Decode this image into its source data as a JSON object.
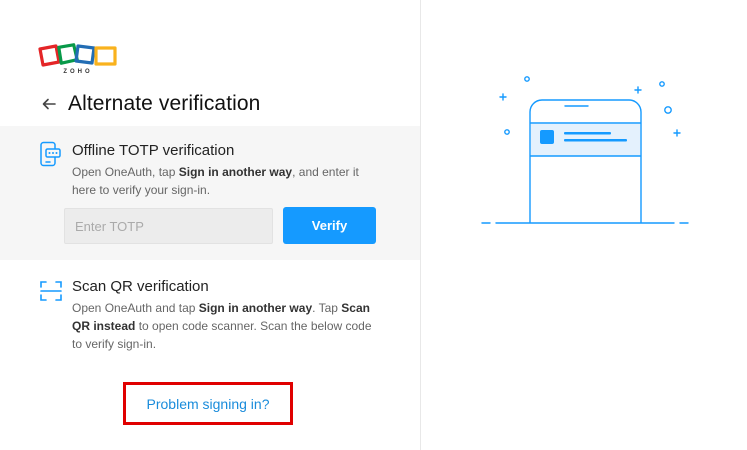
{
  "brand": {
    "logo_text": "ZOHO"
  },
  "header": {
    "title": "Alternate verification"
  },
  "totp": {
    "title": "Offline TOTP verification",
    "desc_1": "Open OneAuth, tap ",
    "desc_bold_1": "Sign in another way",
    "desc_2": ", and enter it here to verify your sign-in.",
    "input_placeholder": "Enter TOTP",
    "input_value": "",
    "verify_label": "Verify"
  },
  "qr": {
    "title": "Scan QR verification",
    "desc_1": "Open OneAuth and tap ",
    "desc_bold_1": "Sign in another way",
    "desc_2": ". Tap ",
    "desc_bold_2": "Scan QR instead",
    "desc_3": " to open code scanner. Scan the below code to verify sign-in."
  },
  "footer": {
    "problem_link": "Problem signing in?"
  },
  "colors": {
    "accent": "#159aff",
    "link": "#1a8cdb",
    "highlight_box": "#e00000",
    "logo_red": "#e42527",
    "logo_green": "#089949",
    "logo_blue": "#226db4",
    "logo_yellow": "#f9b21d"
  },
  "icons": {
    "back": "arrow-left-icon",
    "totp": "phone-keypad-icon",
    "qr": "qr-scan-icon"
  }
}
